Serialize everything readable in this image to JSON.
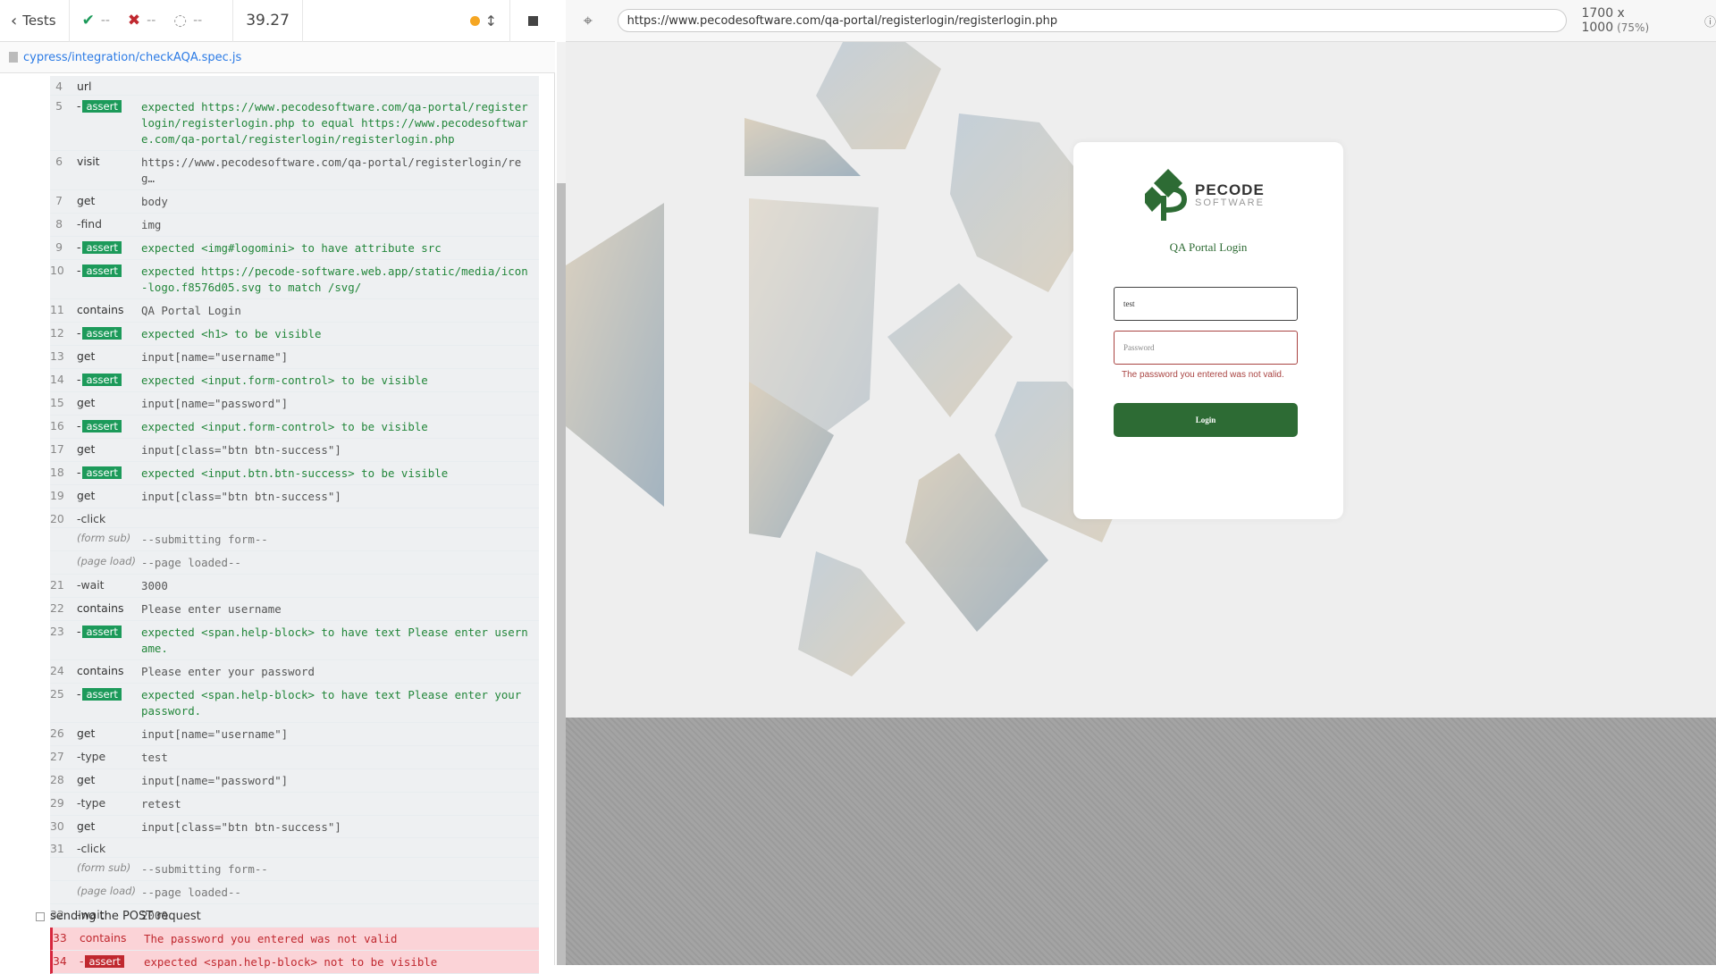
{
  "reporter": {
    "tests_label": "Tests",
    "passed": "--",
    "failed": "--",
    "pending": "--",
    "duration": "39.27",
    "spec_path": "cypress/integration/checkAQA.spec.js",
    "footer_test": "sending the POST request"
  },
  "log": [
    {
      "num": "4",
      "cmd": "url",
      "msg": "",
      "type": "cmd"
    },
    {
      "num": "5",
      "cmd": "assert",
      "msg": "expected https://www.pecodesoftware.com/qa-portal/registerlogin/registerlogin.php to equal https://www.pecodesoftware.com/qa-portal/registerlogin/registerlogin.php",
      "type": "assert"
    },
    {
      "num": "6",
      "cmd": "visit",
      "msg": "https://www.pecodesoftware.com/qa-portal/registerlogin/reg…",
      "type": "cmd"
    },
    {
      "num": "7",
      "cmd": "get",
      "msg": "body",
      "type": "cmd"
    },
    {
      "num": "8",
      "cmd": "-find",
      "msg": "img",
      "type": "child"
    },
    {
      "num": "9",
      "cmd": "assert",
      "msg": "expected <img#logomini> to have attribute src",
      "type": "assert"
    },
    {
      "num": "10",
      "cmd": "assert",
      "msg": "expected https://pecode-software.web.app/static/media/icon-logo.f8576d05.svg to match /svg/",
      "type": "assert"
    },
    {
      "num": "11",
      "cmd": "contains",
      "msg": "QA Portal Login",
      "type": "cmd"
    },
    {
      "num": "12",
      "cmd": "assert",
      "msg": "expected <h1> to be visible",
      "type": "assert"
    },
    {
      "num": "13",
      "cmd": "get",
      "msg": "input[name=\"username\"]",
      "type": "cmd"
    },
    {
      "num": "14",
      "cmd": "assert",
      "msg": "expected <input.form-control> to be visible",
      "type": "assert"
    },
    {
      "num": "15",
      "cmd": "get",
      "msg": "input[name=\"password\"]",
      "type": "cmd"
    },
    {
      "num": "16",
      "cmd": "assert",
      "msg": "expected <input.form-control> to be visible",
      "type": "assert"
    },
    {
      "num": "17",
      "cmd": "get",
      "msg": "input[class=\"btn btn-success\"]",
      "type": "cmd"
    },
    {
      "num": "18",
      "cmd": "assert",
      "msg": "expected <input.btn.btn-success> to be visible",
      "type": "assert"
    },
    {
      "num": "19",
      "cmd": "get",
      "msg": "input[class=\"btn btn-success\"]",
      "type": "cmd"
    },
    {
      "num": "20",
      "cmd": "-click",
      "msg": "",
      "type": "child"
    },
    {
      "num": "",
      "cmd": "(form sub)",
      "msg": "--submitting form--",
      "type": "evt"
    },
    {
      "num": "",
      "cmd": "(page load)",
      "msg": "--page loaded--",
      "type": "evt"
    },
    {
      "num": "21",
      "cmd": "-wait",
      "msg": "3000",
      "type": "child"
    },
    {
      "num": "22",
      "cmd": "contains",
      "msg": "Please enter username",
      "type": "cmd"
    },
    {
      "num": "23",
      "cmd": "assert",
      "msg": "expected <span.help-block> to have text Please enter username.",
      "type": "assert"
    },
    {
      "num": "24",
      "cmd": "contains",
      "msg": "Please enter your password",
      "type": "cmd"
    },
    {
      "num": "25",
      "cmd": "assert",
      "msg": "expected <span.help-block> to have text Please enter your password.",
      "type": "assert"
    },
    {
      "num": "26",
      "cmd": "get",
      "msg": "input[name=\"username\"]",
      "type": "cmd"
    },
    {
      "num": "27",
      "cmd": "-type",
      "msg": "test",
      "type": "child"
    },
    {
      "num": "28",
      "cmd": "get",
      "msg": "input[name=\"password\"]",
      "type": "cmd"
    },
    {
      "num": "29",
      "cmd": "-type",
      "msg": "retest",
      "type": "child"
    },
    {
      "num": "30",
      "cmd": "get",
      "msg": "input[class=\"btn btn-success\"]",
      "type": "cmd"
    },
    {
      "num": "31",
      "cmd": "-click",
      "msg": "",
      "type": "child"
    },
    {
      "num": "",
      "cmd": "(form sub)",
      "msg": "--submitting form--",
      "type": "evt"
    },
    {
      "num": "",
      "cmd": "(page load)",
      "msg": "--page loaded--",
      "type": "evt"
    },
    {
      "num": "32",
      "cmd": "-wait",
      "msg": "2000",
      "type": "child"
    },
    {
      "num": "33",
      "cmd": "contains",
      "msg": "The password you entered was not valid",
      "type": "fail"
    },
    {
      "num": "34",
      "cmd": "assert",
      "msg": "expected <span.help-block> not to be visible",
      "type": "fail-assert"
    }
  ],
  "aut": {
    "url": "https://www.pecodesoftware.com/qa-portal/registerlogin/registerlogin.php",
    "viewport": "1700 x 1000",
    "scale": "(75%)"
  },
  "login": {
    "brand_top": "PECODE",
    "brand_bottom": "SOFTWARE",
    "title": "QA Portal Login",
    "username_value": "test",
    "password_placeholder": "Password",
    "error": "The password you entered was not valid.",
    "button": "Login",
    "brand_color": "#2d6b34",
    "error_color": "#a94442"
  }
}
